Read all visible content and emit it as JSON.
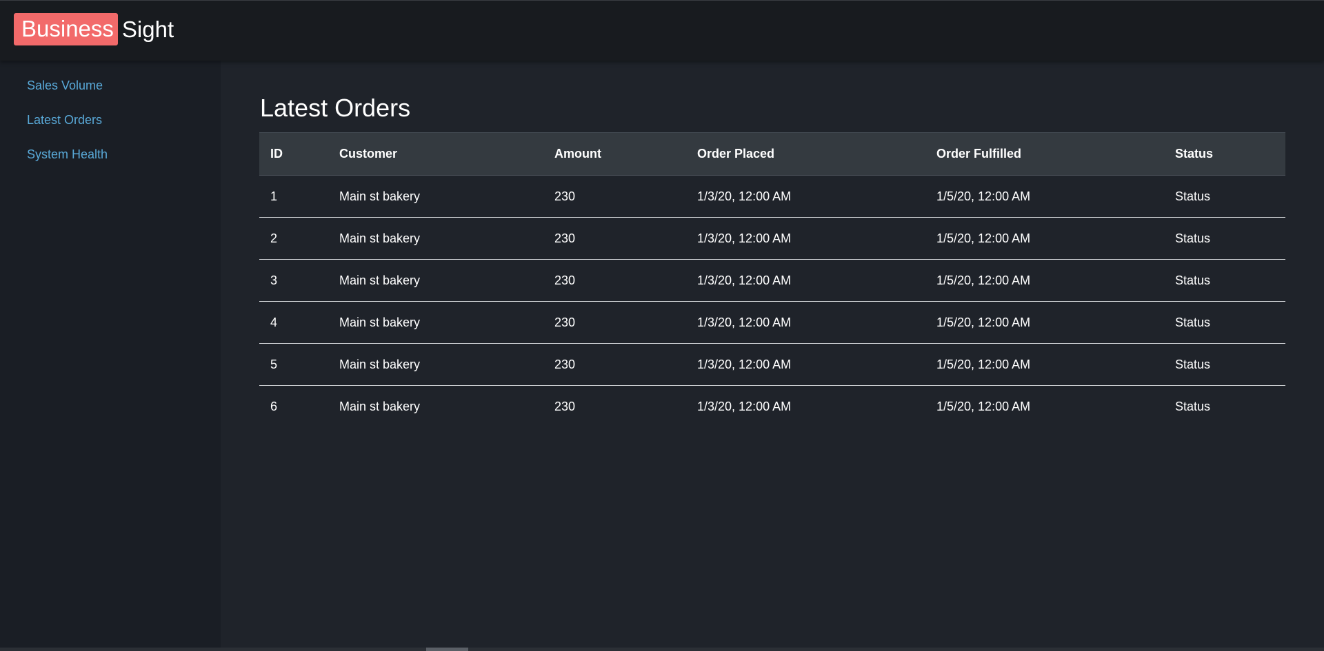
{
  "brand": {
    "highlight": "Business",
    "rest": "Sight",
    "highlight_color": "#f26a6a"
  },
  "sidebar": {
    "items": [
      {
        "label": "Sales Volume"
      },
      {
        "label": "Latest Orders"
      },
      {
        "label": "System Health"
      }
    ],
    "link_color": "#59a9d8"
  },
  "main": {
    "title": "Latest Orders"
  },
  "table": {
    "headers": [
      "ID",
      "Customer",
      "Amount",
      "Order Placed",
      "Order Fulfilled",
      "Status"
    ],
    "rows": [
      [
        "1",
        "Main st bakery",
        "230",
        "1/3/20, 12:00 AM",
        "1/5/20, 12:00 AM",
        "Status"
      ],
      [
        "2",
        "Main st bakery",
        "230",
        "1/3/20, 12:00 AM",
        "1/5/20, 12:00 AM",
        "Status"
      ],
      [
        "3",
        "Main st bakery",
        "230",
        "1/3/20, 12:00 AM",
        "1/5/20, 12:00 AM",
        "Status"
      ],
      [
        "4",
        "Main st bakery",
        "230",
        "1/3/20, 12:00 AM",
        "1/5/20, 12:00 AM",
        "Status"
      ],
      [
        "5",
        "Main st bakery",
        "230",
        "1/3/20, 12:00 AM",
        "1/5/20, 12:00 AM",
        "Status"
      ],
      [
        "6",
        "Main st bakery",
        "230",
        "1/3/20, 12:00 AM",
        "1/5/20, 12:00 AM",
        "Status"
      ]
    ]
  }
}
